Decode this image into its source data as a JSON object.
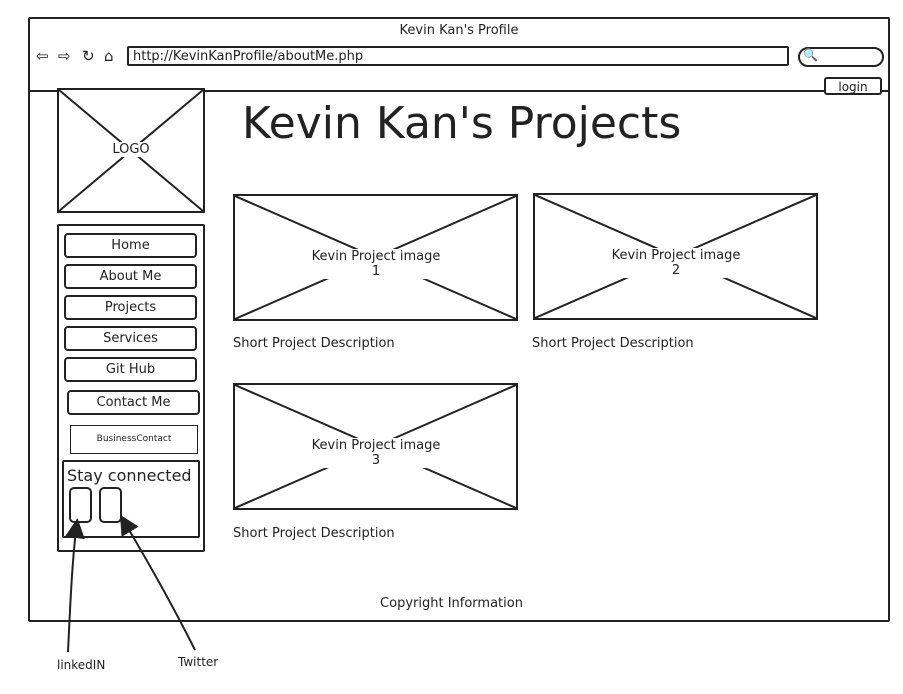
{
  "browser": {
    "title": "Kevin Kan's Profile",
    "url": "http://KevinKanProfile/aboutMe.php",
    "back_glyph": "⇦",
    "forward_glyph": "⇨",
    "refresh_glyph": "↻",
    "home_glyph": "⌂",
    "search_glyph": "🔍"
  },
  "header": {
    "login_label": "login"
  },
  "logo": {
    "label": "LOGO"
  },
  "sidebar": {
    "items": [
      {
        "label": "Home"
      },
      {
        "label": "About Me"
      },
      {
        "label": "Projects"
      },
      {
        "label": "Services"
      },
      {
        "label": "Git Hub"
      },
      {
        "label": "Contact Me"
      }
    ],
    "business_contact": "BusinessContact",
    "stay_connected": "Stay connected"
  },
  "main": {
    "heading": "Kevin Kan's Projects",
    "projects": [
      {
        "image_label": "Kevin Project image 1",
        "description": "Short Project Description"
      },
      {
        "image_label": "Kevin Project image 2",
        "description": "Short Project Description"
      },
      {
        "image_label": "Kevin Project image 3",
        "description": "Short Project Description"
      }
    ]
  },
  "footer": {
    "copyright": "Copyright Information"
  },
  "annotations": {
    "linkedin": "linkedIN",
    "twitter": "Twitter"
  }
}
